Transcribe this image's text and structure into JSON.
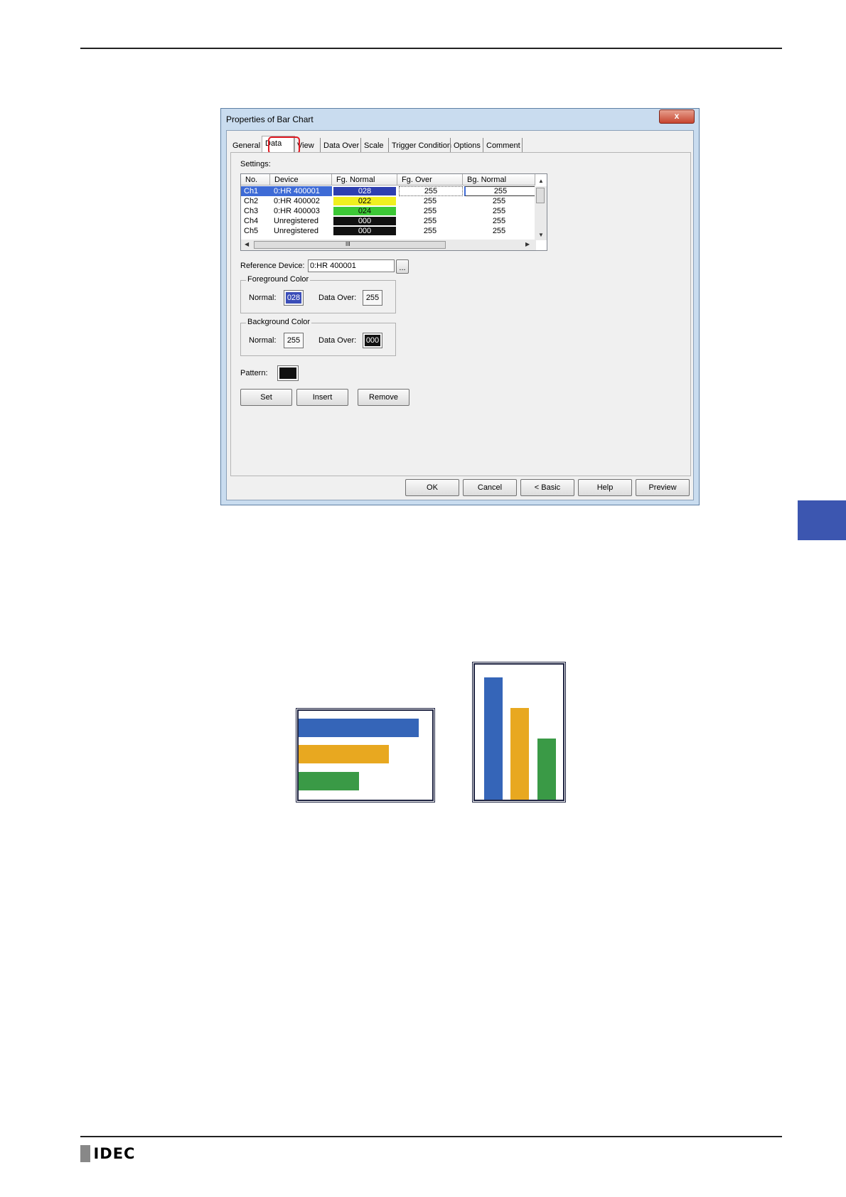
{
  "dialog": {
    "title": "Properties of Bar Chart",
    "close_label": "x",
    "tabs": [
      "General",
      "Data",
      "View",
      "Data Over",
      "Scale",
      "Trigger Condition",
      "Options",
      "Comment"
    ],
    "active_tab": "Data",
    "settings_label": "Settings:",
    "columns": [
      "No.",
      "Device",
      "Fg. Normal",
      "Fg. Over",
      "Bg. Normal"
    ],
    "rows": [
      {
        "no": "Ch1",
        "device": "0:HR 400001",
        "fg_normal": "028",
        "fg_normal_color": "#2e3fb0",
        "fg_over": "255",
        "bg_normal": "255",
        "selected": true
      },
      {
        "no": "Ch2",
        "device": "0:HR 400002",
        "fg_normal": "022",
        "fg_normal_color": "#f0f020",
        "fg_over": "255",
        "bg_normal": "255"
      },
      {
        "no": "Ch3",
        "device": "0:HR 400003",
        "fg_normal": "024",
        "fg_normal_color": "#3cc836",
        "fg_over": "255",
        "bg_normal": "255"
      },
      {
        "no": "Ch4",
        "device": "Unregistered",
        "fg_normal": "000",
        "fg_normal_color": "#111111",
        "fg_over": "255",
        "bg_normal": "255"
      },
      {
        "no": "Ch5",
        "device": "Unregistered",
        "fg_normal": "000",
        "fg_normal_color": "#111111",
        "fg_over": "255",
        "bg_normal": "255"
      }
    ],
    "hscroll_grip": "III",
    "reference_device_label": "Reference Device:",
    "reference_device_value": "0:HR 400001",
    "browse_label": "...",
    "foreground": {
      "group_label": "Foreground Color",
      "normal_label": "Normal:",
      "normal_value": "028",
      "data_over_label": "Data Over:",
      "data_over_value": "255"
    },
    "background": {
      "group_label": "Background Color",
      "normal_label": "Normal:",
      "normal_value": "255",
      "data_over_label": "Data Over:",
      "data_over_value": "000"
    },
    "pattern_label": "Pattern:",
    "buttons": {
      "set": "Set",
      "insert": "Insert",
      "remove": "Remove"
    },
    "footer_buttons": {
      "ok": "OK",
      "cancel": "Cancel",
      "basic": "< Basic",
      "help": "Help",
      "preview": "Preview"
    }
  },
  "colors": {
    "blue": "#3565b8",
    "orange": "#e8a820",
    "green": "#3a9a46",
    "accent": "#3c56b0",
    "highlight": "#e01b24"
  },
  "footer": {
    "logo": "IDEC"
  }
}
